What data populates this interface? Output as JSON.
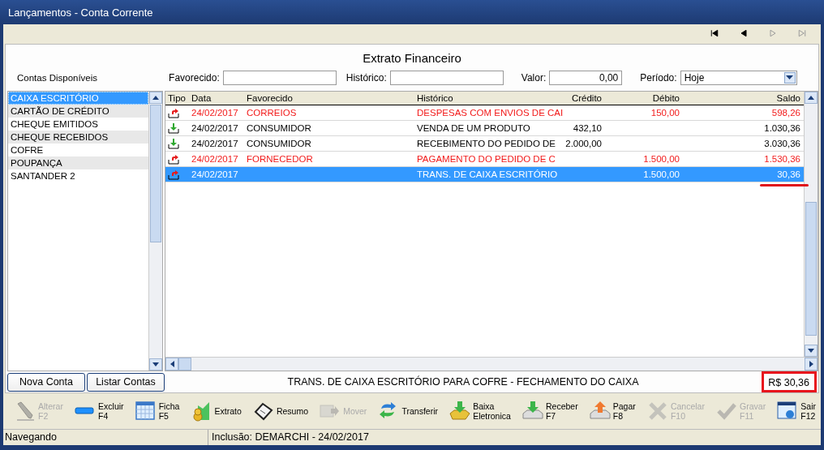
{
  "window": {
    "title": "Lançamentos - Conta Corrente"
  },
  "nav": [
    {
      "kind": "first",
      "disabled": false
    },
    {
      "kind": "prev",
      "disabled": false
    },
    {
      "kind": "next",
      "disabled": true
    },
    {
      "kind": "last",
      "disabled": true
    }
  ],
  "heading": "Extrato Financeiro",
  "accounts_label": "Contas Disponíveis",
  "filters": {
    "favorecido": {
      "label": "Favorecido:"
    },
    "historico": {
      "label": "Histórico:"
    },
    "valor": {
      "label": "Valor:",
      "value": "0,00"
    },
    "periodo": {
      "label": "Período:",
      "value": "Hoje"
    }
  },
  "accounts": [
    {
      "name": "CAIXA ESCRITÓRIO",
      "selected": true
    },
    {
      "name": "CARTÃO DE CRÉDITO",
      "selected": false
    },
    {
      "name": "CHEQUE EMITIDOS",
      "selected": false
    },
    {
      "name": "CHEQUE RECEBIDOS",
      "selected": false
    },
    {
      "name": "COFRE",
      "selected": false
    },
    {
      "name": "POUPANÇA",
      "selected": false
    },
    {
      "name": "SANTANDER 2",
      "selected": false
    }
  ],
  "table": {
    "columns": [
      "Tipo",
      "Data",
      "Favorecido",
      "Histórico",
      "Crédito",
      "Débito",
      "Saldo"
    ],
    "rows": [
      {
        "kind": "debit",
        "selected": false,
        "marked": false,
        "data": "24/02/2017",
        "favorecido": "CORREIOS",
        "historico": "DESPESAS COM ENVIOS DE CAI",
        "credito": "",
        "debito": "150,00",
        "saldo": "598,26"
      },
      {
        "kind": "credit",
        "selected": false,
        "marked": false,
        "data": "24/02/2017",
        "favorecido": "CONSUMIDOR",
        "historico": "VENDA DE UM PRODUTO",
        "credito": "432,10",
        "debito": "",
        "saldo": "1.030,36"
      },
      {
        "kind": "credit",
        "selected": false,
        "marked": false,
        "data": "24/02/2017",
        "favorecido": "CONSUMIDOR",
        "historico": "RECEBIMENTO DO PEDIDO DE",
        "credito": "2.000,00",
        "debito": "",
        "saldo": "3.030,36"
      },
      {
        "kind": "debit",
        "selected": false,
        "marked": false,
        "data": "24/02/2017",
        "favorecido": "FORNECEDOR",
        "historico": "PAGAMENTO DO PEDIDO DE C",
        "credito": "",
        "debito": "1.500,00",
        "saldo": "1.530,36"
      },
      {
        "kind": "debit",
        "selected": true,
        "marked": true,
        "data": "24/02/2017",
        "favorecido": "",
        "historico": "TRANS. DE CAIXA ESCRITÓRIO",
        "credito": "",
        "debito": "1.500,00",
        "saldo": "30,36"
      }
    ]
  },
  "buttons": [
    "Nova Conta",
    "Listar Contas"
  ],
  "description": "TRANS. DE CAIXA ESCRITÓRIO PARA COFRE - FECHAMENTO DO CAIXA",
  "total": {
    "text": "R$ 30,36",
    "boxed": true
  },
  "toolbar": [
    {
      "kind": "edit",
      "label": "Alterar",
      "key": "F2",
      "disabled": true
    },
    {
      "kind": "delete",
      "label": "Excluir",
      "key": "F4",
      "disabled": false
    },
    {
      "kind": "card",
      "label": "Ficha",
      "key": "F5",
      "disabled": false
    },
    {
      "kind": "statement",
      "label": "Extrato",
      "disabled": false
    },
    {
      "kind": "summary",
      "label": "Resumo",
      "disabled": false
    },
    {
      "kind": "move",
      "label": "Mover",
      "disabled": true
    },
    {
      "kind": "transfer",
      "label": "Transferir",
      "disabled": false
    },
    {
      "kind": "bank",
      "label": "Baixa",
      "key": "Eletronica",
      "disabled": false
    },
    {
      "kind": "receive",
      "label": "Receber",
      "key": "F7",
      "disabled": false
    },
    {
      "kind": "pay",
      "label": "Pagar",
      "key": "F8",
      "disabled": false
    },
    {
      "kind": "cancel",
      "label": "Cancelar",
      "key": "F10",
      "disabled": true
    },
    {
      "kind": "save",
      "label": "Gravar",
      "key": "F11",
      "disabled": true
    },
    {
      "kind": "exit",
      "label": "Sair",
      "key": "F12",
      "disabled": false
    }
  ],
  "status_bar": [
    "Navegando",
    "Inclusão: DEMARCHI - 24/02/2017"
  ]
}
